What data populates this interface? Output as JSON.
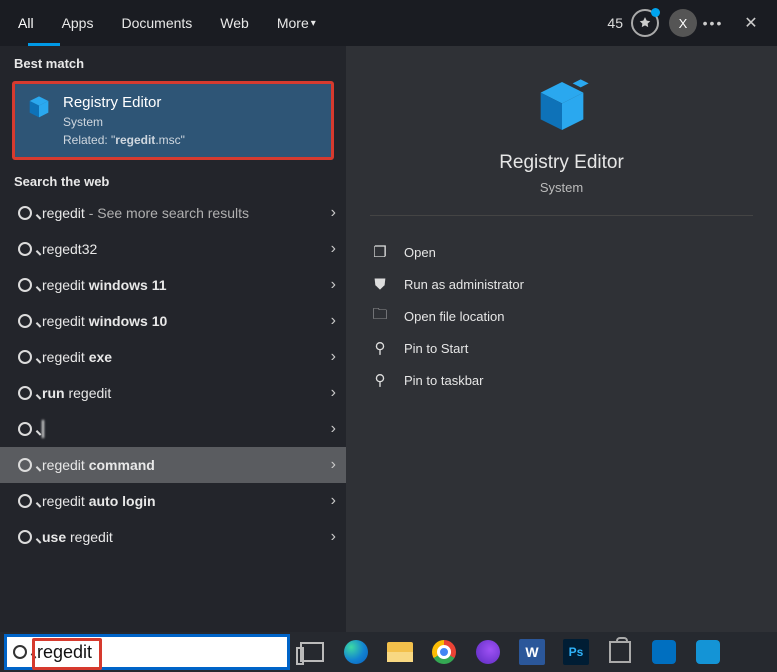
{
  "tabs": {
    "items": [
      {
        "label": "All",
        "active": true
      },
      {
        "label": "Apps"
      },
      {
        "label": "Documents"
      },
      {
        "label": "Web"
      },
      {
        "label": "More"
      }
    ],
    "points": "45",
    "avatar_letter": "X"
  },
  "sections": {
    "best_match_label": "Best match",
    "search_web_label": "Search the web"
  },
  "best_match": {
    "title": "Registry Editor",
    "subtitle": "System",
    "related_prefix": "Related: ",
    "related_quote_pre": "\"",
    "related_bold": "regedit",
    "related_rest": ".msc\""
  },
  "web": [
    {
      "pre": "regedit",
      "dim": " - See more search results"
    },
    {
      "pre": "regedt32"
    },
    {
      "pre": "regedit ",
      "bold": "windows 11"
    },
    {
      "pre": "regedit ",
      "bold": "windows 10"
    },
    {
      "pre": "regedit ",
      "bold": "exe"
    },
    {
      "bold": "run ",
      "post": "regedit"
    },
    {
      "redacted": true
    },
    {
      "pre": "regedit ",
      "bold": "command",
      "hovered": true
    },
    {
      "pre": "regedit ",
      "bold": "auto login"
    },
    {
      "bold": "use ",
      "post": "regedit"
    }
  ],
  "preview": {
    "title": "Registry Editor",
    "subtitle": "System",
    "actions": {
      "open": "Open",
      "runadmin": "Run as administrator",
      "openloc": "Open file location",
      "pinstart": "Pin to Start",
      "pintb": "Pin to taskbar"
    }
  },
  "search": {
    "value": "regedit"
  }
}
